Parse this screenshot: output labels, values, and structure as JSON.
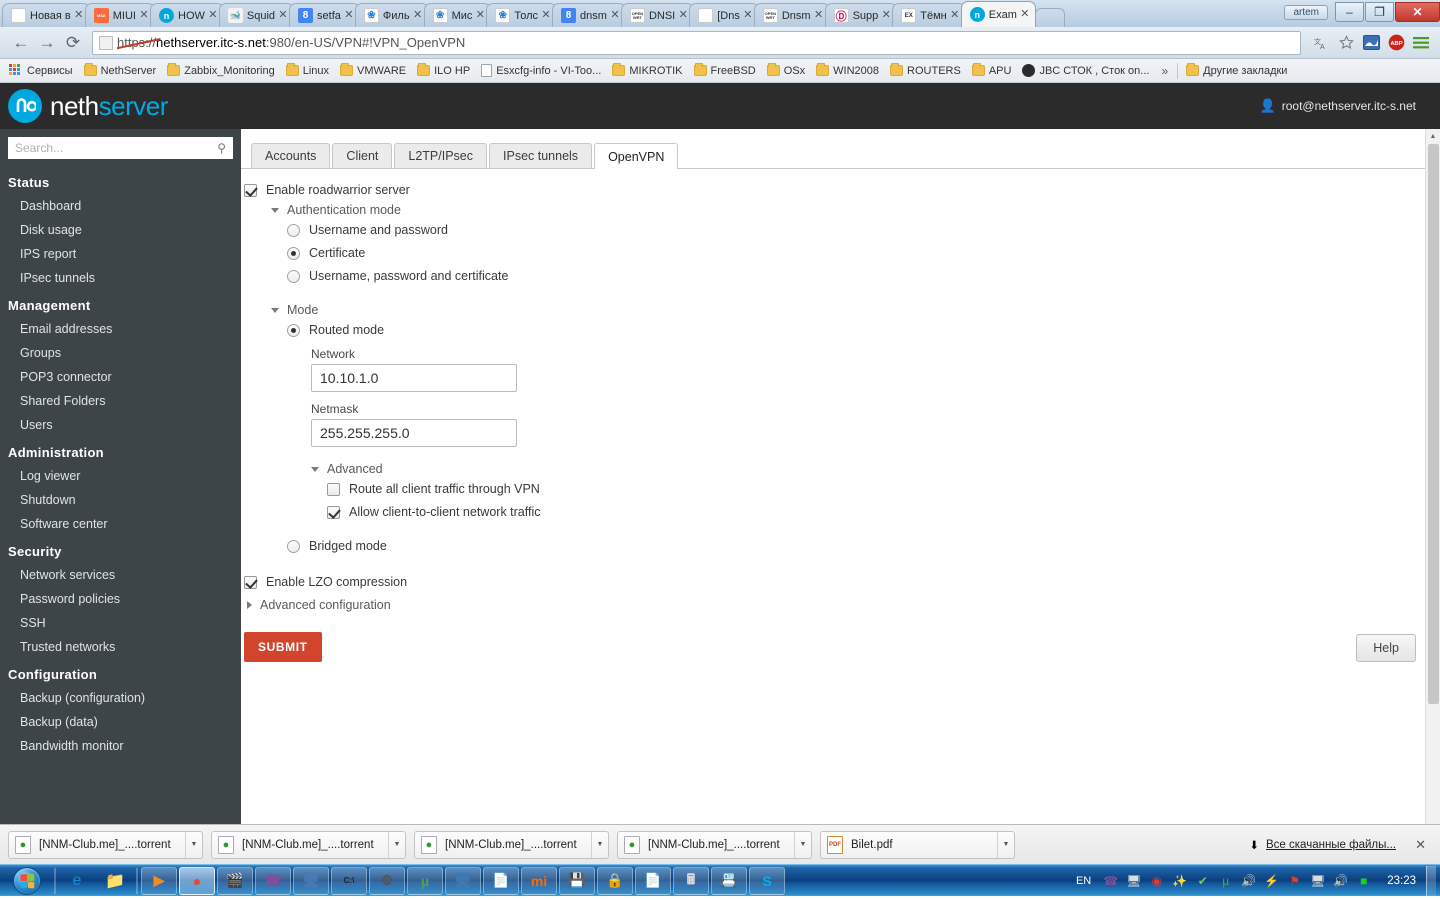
{
  "browser": {
    "tabs": [
      {
        "title": "Новая в",
        "favicon": "blank-icon",
        "color": "#ffffff",
        "glyph": "",
        "active": false
      },
      {
        "title": "MIUI",
        "favicon": "miui-icon",
        "color": "#ff6a3d",
        "glyph": "MIUI",
        "active": false
      },
      {
        "title": "HOW",
        "favicon": "nethserver-icon",
        "color": "#00a8e0",
        "glyph": "n",
        "active": false
      },
      {
        "title": "Squid",
        "favicon": "squid-icon",
        "color": "#f2f2f2",
        "glyph": "",
        "active": false
      },
      {
        "title": "setfa",
        "favicon": "google-icon",
        "color": "#4285f4",
        "glyph": "8",
        "active": false
      },
      {
        "title": "Филь",
        "favicon": "butterfly-icon",
        "color": "#ffffff",
        "glyph": "",
        "active": false
      },
      {
        "title": "Мис",
        "favicon": "butterfly-icon",
        "color": "#ffffff",
        "glyph": "",
        "active": false
      },
      {
        "title": "Толс",
        "favicon": "butterfly-icon",
        "color": "#ffffff",
        "glyph": "",
        "active": false
      },
      {
        "title": "dnsm",
        "favicon": "google-icon",
        "color": "#4285f4",
        "glyph": "8",
        "active": false
      },
      {
        "title": "DNSI",
        "favicon": "openwrt-icon",
        "color": "#ffffff",
        "glyph": "OW",
        "active": false
      },
      {
        "title": "[Dns",
        "favicon": "document-icon",
        "color": "#ffffff",
        "glyph": "",
        "active": false
      },
      {
        "title": "Dnsm",
        "favicon": "openwrt-icon",
        "color": "#ffffff",
        "glyph": "OW",
        "active": false
      },
      {
        "title": "Supp",
        "favicon": "debian-icon",
        "color": "#ffffff",
        "glyph": "",
        "active": false
      },
      {
        "title": "Тёмн",
        "favicon": "ex-icon",
        "color": "#ffffff",
        "glyph": "EX",
        "active": false
      },
      {
        "title": "Exam",
        "favicon": "nethserver-icon",
        "color": "#00a8e0",
        "glyph": "n",
        "active": true
      }
    ],
    "window": {
      "user_label": "artem",
      "minimize": "–",
      "maximize": "❐",
      "close": "✕"
    },
    "nav": {
      "back": "←",
      "forward": "→",
      "reload": "⟳"
    },
    "omnibox": {
      "scheme": "https",
      "separator": "://",
      "host": "nethserver.itc-s.net",
      "rest": ":980/en-US/VPN#!VPN_OpenVPN",
      "full_url": "https://nethserver.itc-s.net:980/en-US/VPN#!VPN_OpenVPN"
    },
    "toolbar_icons": [
      {
        "name": "translate-icon",
        "glyph": "🗛"
      },
      {
        "name": "bookmark-star-icon",
        "glyph": "☆"
      },
      {
        "name": "extension-icon",
        "glyph": "▣"
      },
      {
        "name": "adblock-icon",
        "glyph": "ABP"
      },
      {
        "name": "chrome-menu-icon",
        "glyph": "≡"
      }
    ],
    "bookmarks": [
      {
        "label": "Сервисы",
        "icon": "apps-grid-icon"
      },
      {
        "label": "NethServer",
        "icon": "folder-icon"
      },
      {
        "label": "Zabbix_Monitoring",
        "icon": "folder-icon"
      },
      {
        "label": "Linux",
        "icon": "folder-icon"
      },
      {
        "label": "VMWARE",
        "icon": "folder-icon"
      },
      {
        "label": "ILO HP",
        "icon": "folder-icon"
      },
      {
        "label": "Esxcfg-info - VI-Too...",
        "icon": "document-icon"
      },
      {
        "label": "MIKROTIK",
        "icon": "folder-icon"
      },
      {
        "label": "FreeBSD",
        "icon": "folder-icon"
      },
      {
        "label": "OSx",
        "icon": "folder-icon"
      },
      {
        "label": "WIN2008",
        "icon": "folder-icon"
      },
      {
        "label": "ROUTERS",
        "icon": "folder-icon"
      },
      {
        "label": "APU",
        "icon": "folder-icon"
      },
      {
        "label": "JBC СТОК , Сток on...",
        "icon": "circle-icon"
      }
    ],
    "bookmarks_overflow": "»",
    "other_bookmarks": {
      "label": "Другие закладки",
      "icon": "folder-icon"
    },
    "downloads": {
      "items": [
        {
          "name": "[NNM-Club.me]_....torrent",
          "icon": "torrent-icon"
        },
        {
          "name": "[NNM-Club.me]_....torrent",
          "icon": "torrent-icon"
        },
        {
          "name": "[NNM-Club.me]_....torrent",
          "icon": "torrent-icon"
        },
        {
          "name": "[NNM-Club.me]_....torrent",
          "icon": "torrent-icon"
        },
        {
          "name": "Bilet.pdf",
          "icon": "pdf-icon"
        }
      ],
      "show_all_label": "Все скачанные файлы...",
      "close_label": "✕"
    }
  },
  "app": {
    "logo": {
      "part1": "neth",
      "part2": "server"
    },
    "user": "root@nethserver.itc-s.net",
    "search": {
      "placeholder": "Search...",
      "value": ""
    },
    "sidebar": [
      {
        "group": "Status",
        "items": [
          "Dashboard",
          "Disk usage",
          "IPS report",
          "IPsec tunnels"
        ]
      },
      {
        "group": "Management",
        "items": [
          "Email addresses",
          "Groups",
          "POP3 connector",
          "Shared Folders",
          "Users"
        ]
      },
      {
        "group": "Administration",
        "items": [
          "Log viewer",
          "Shutdown",
          "Software center"
        ]
      },
      {
        "group": "Security",
        "items": [
          "Network services",
          "Password policies",
          "SSH",
          "Trusted networks"
        ]
      },
      {
        "group": "Configuration",
        "items": [
          "Backup (configuration)",
          "Backup (data)",
          "Bandwidth monitor"
        ]
      }
    ],
    "tabs": [
      {
        "label": "Accounts",
        "active": false
      },
      {
        "label": "Client",
        "active": false
      },
      {
        "label": "L2TP/IPsec",
        "active": false
      },
      {
        "label": "IPsec tunnels",
        "active": false
      },
      {
        "label": "OpenVPN",
        "active": true
      }
    ],
    "form": {
      "enable_roadwarrior": {
        "label": "Enable roadwarrior server",
        "checked": true
      },
      "auth_mode": {
        "label": "Authentication mode",
        "expanded": true,
        "options": [
          {
            "label": "Username and password",
            "selected": false
          },
          {
            "label": "Certificate",
            "selected": true
          },
          {
            "label": "Username, password and certificate",
            "selected": false
          }
        ]
      },
      "mode": {
        "label": "Mode",
        "expanded": true,
        "routed": {
          "label": "Routed mode",
          "selected": true
        },
        "network": {
          "label": "Network",
          "value": "10.10.1.0"
        },
        "netmask": {
          "label": "Netmask",
          "value": "255.255.255.0"
        },
        "advanced": {
          "label": "Advanced",
          "expanded": true,
          "options": [
            {
              "label": "Route all client traffic through VPN",
              "checked": false
            },
            {
              "label": "Allow client-to-client network traffic",
              "checked": true
            }
          ]
        },
        "bridged": {
          "label": "Bridged mode",
          "selected": false
        }
      },
      "lzo": {
        "label": "Enable LZO compression",
        "checked": true
      },
      "advanced_config": {
        "label": "Advanced configuration",
        "expanded": false
      },
      "submit_label": "SUBMIT",
      "help_label": "Help"
    }
  },
  "taskbar": {
    "start_label": "Start",
    "quick_launch": [
      {
        "name": "internet-explorer-icon"
      },
      {
        "name": "file-explorer-icon"
      }
    ],
    "tasks": [
      {
        "name": "media-player-icon"
      },
      {
        "name": "chrome-icon",
        "active": true
      },
      {
        "name": "vlc-icon"
      },
      {
        "name": "viber-icon"
      },
      {
        "name": "remote-desktop-icon"
      },
      {
        "name": "command-prompt-icon"
      },
      {
        "name": "settings-icon"
      },
      {
        "name": "utorrent-icon"
      },
      {
        "name": "monitor-icon"
      },
      {
        "name": "notepad-icon"
      },
      {
        "name": "mi-icon"
      },
      {
        "name": "save-icon"
      },
      {
        "name": "secure-folder-icon"
      },
      {
        "name": "notepad2-icon"
      },
      {
        "name": "calculator-icon"
      },
      {
        "name": "contacts-icon"
      },
      {
        "name": "skype-icon"
      }
    ],
    "tray": {
      "language": "EN",
      "icons": [
        {
          "name": "viber-tray-icon"
        },
        {
          "name": "remote-lock-icon"
        },
        {
          "name": "record-icon"
        },
        {
          "name": "wizard-icon"
        },
        {
          "name": "shield-green-icon"
        },
        {
          "name": "utorrent-tray-icon"
        },
        {
          "name": "volume-red-icon"
        },
        {
          "name": "usb-safe-remove-icon"
        },
        {
          "name": "network-error-icon"
        },
        {
          "name": "network-icon"
        },
        {
          "name": "speaker-icon"
        },
        {
          "name": "green-screen-icon"
        }
      ],
      "clock": "23:23"
    }
  }
}
